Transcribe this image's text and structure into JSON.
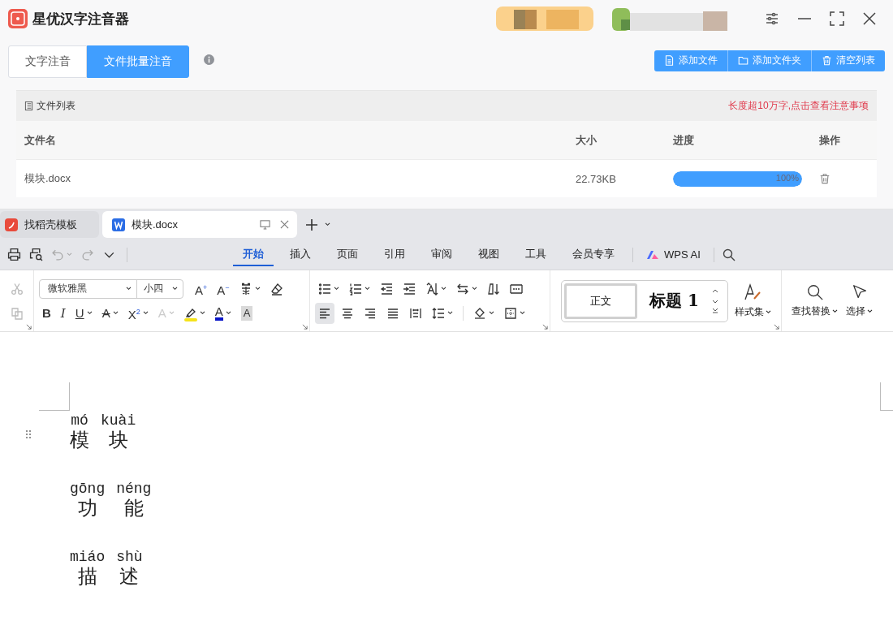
{
  "app": {
    "title": "星优汉字注音器",
    "tabs": [
      {
        "label": "文字注音",
        "selected": false
      },
      {
        "label": "文件批量注音",
        "selected": true
      }
    ],
    "buttons": [
      {
        "label": "添加文件",
        "kind": "file"
      },
      {
        "label": "添加文件夹",
        "kind": "folder"
      },
      {
        "label": "清空列表",
        "kind": "trash"
      }
    ]
  },
  "file_list": {
    "title": "文件列表",
    "notice": "长度超10万字,点击查看注意事项",
    "columns": [
      "文件名",
      "大小",
      "进度",
      "操作"
    ],
    "rows": [
      {
        "name": "模块.docx",
        "size": "22.73KB",
        "level": 1,
        "progress": "100%"
      }
    ]
  },
  "wps": {
    "tabs": [
      {
        "label": "找稻壳模板",
        "selected": false,
        "kind": "docer"
      },
      {
        "label": "模块.docx",
        "selected": true,
        "kind": "writer"
      }
    ],
    "quick": [
      {
        "kind": "print",
        "disabled": false,
        "caret": false
      },
      {
        "kind": "preview",
        "disabled": false,
        "caret": false
      },
      {
        "kind": "undo",
        "disabled": true,
        "caret": true
      },
      {
        "kind": "redo",
        "disabled": true,
        "caret": false
      },
      {
        "kind": "more",
        "disabled": false,
        "caret": false
      }
    ],
    "menu": [
      {
        "label": "开始",
        "selected": true
      },
      {
        "label": "插入",
        "selected": false
      },
      {
        "label": "页面",
        "selected": false
      },
      {
        "label": "引用",
        "selected": false
      },
      {
        "label": "审阅",
        "selected": false
      },
      {
        "label": "视图",
        "selected": false
      },
      {
        "label": "工具",
        "selected": false
      },
      {
        "label": "会员专享",
        "selected": false
      }
    ],
    "ai": "WPS AI",
    "font": {
      "name": "微软雅黑",
      "size": "小四"
    },
    "clipboard": [
      {
        "kind": "cut",
        "disabled": true,
        "caret": false
      },
      {
        "kind": "copy",
        "disabled": true,
        "caret": false
      }
    ],
    "font_rows": [
      [
        {
          "kind": "grow",
          "text": "A$^{+}$",
          "caret": false,
          "disabled": false
        },
        {
          "kind": "shrink",
          "text": "A$^{−}$",
          "caret": false,
          "disabled": false
        },
        {
          "kind": "phonetic",
          "caret": true,
          "disabled": false
        },
        {
          "kind": "eraser",
          "caret": false,
          "disabled": false
        }
      ],
      [
        {
          "kind": "bold",
          "text": "B",
          "caret": false,
          "disabled": false
        },
        {
          "kind": "italic",
          "text": "I",
          "caret": false,
          "disabled": false
        },
        {
          "kind": "underline",
          "text": "U",
          "caret": true,
          "disabled": false
        },
        {
          "kind": "strike",
          "text": "A",
          "caret": true,
          "disabled": false
        },
        {
          "kind": "super",
          "text": "X$^{2}$",
          "caret": true,
          "disabled": false
        },
        {
          "kind": "effect",
          "text": "A",
          "caret": true,
          "disabled": true
        },
        {
          "kind": "highlight",
          "color": "#f5e31b",
          "caret": true,
          "disabled": false
        },
        {
          "kind": "fontcolor",
          "text": "A",
          "color": "#0a16c8",
          "caret": true,
          "disabled": false
        },
        {
          "kind": "shading",
          "text": "A",
          "caret": false,
          "disabled": false
        }
      ]
    ],
    "para_rows": [
      [
        {
          "kind": "bullets",
          "caret": true,
          "selected": false
        },
        {
          "kind": "numbers",
          "caret": true,
          "selected": false
        },
        {
          "kind": "outdent",
          "caret": false,
          "selected": false
        },
        {
          "kind": "indent",
          "caret": false,
          "selected": false
        },
        {
          "kind": "direction",
          "caret": true,
          "selected": false
        },
        {
          "kind": "swap",
          "caret": true,
          "selected": false
        },
        {
          "kind": "sort",
          "caret": false,
          "selected": false
        },
        {
          "kind": "columns",
          "caret": false,
          "selected": false
        }
      ],
      [
        {
          "kind": "left",
          "caret": false,
          "selected": true
        },
        {
          "kind": "center",
          "caret": false,
          "selected": false
        },
        {
          "kind": "right",
          "caret": false,
          "selected": false
        },
        {
          "kind": "justify",
          "caret": false,
          "selected": false
        },
        {
          "kind": "distribute",
          "caret": false,
          "selected": false
        },
        {
          "kind": "spacing",
          "caret": true,
          "selected": false
        },
        {
          "kind": "fill",
          "caret": true,
          "selected": false
        },
        {
          "kind": "border",
          "caret": true,
          "selected": false
        }
      ]
    ],
    "styles": [
      {
        "label": "正文",
        "selected": true
      },
      {
        "label": "标题 1",
        "selected": false
      }
    ],
    "style_set": "样式集",
    "find": "查找替换",
    "select": "选择"
  },
  "document": {
    "lines": [
      [
        {
          "pinyin": "mó",
          "hanzi": "模"
        },
        {
          "pinyin": "kuài",
          "hanzi": "块"
        }
      ],
      [
        {
          "pinyin": "gōng",
          "hanzi": "功"
        },
        {
          "pinyin": "néng",
          "hanzi": "能"
        }
      ],
      [
        {
          "pinyin": "miáo",
          "hanzi": "描"
        },
        {
          "pinyin": "shù",
          "hanzi": "述"
        }
      ]
    ]
  }
}
